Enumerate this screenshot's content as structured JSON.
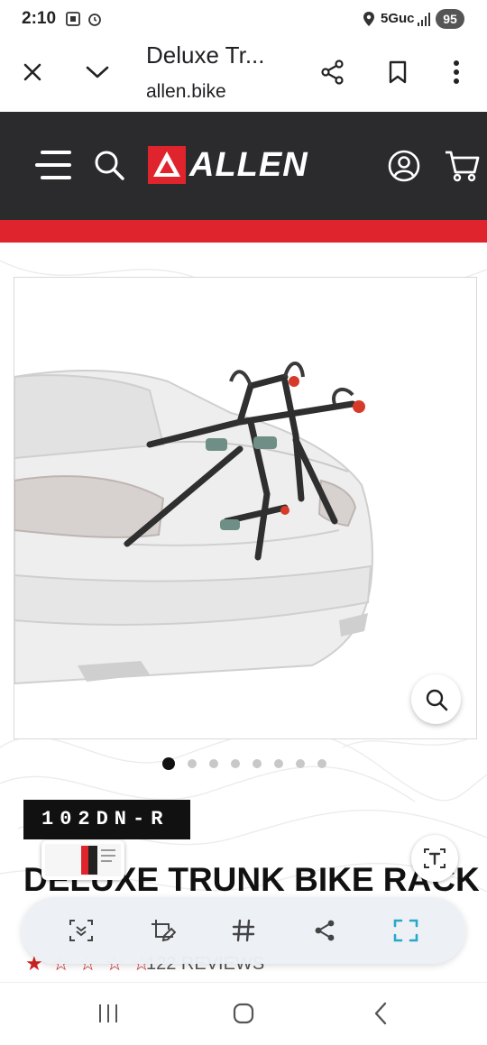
{
  "status_bar": {
    "time": "2:10",
    "network": "5Guc",
    "battery": "95"
  },
  "custom_tab": {
    "title": "Deluxe Tr...",
    "domain": "allen.bike"
  },
  "site": {
    "logo_text": "ALLEN",
    "accent_color": "#e0242d",
    "header_color": "#2b2b2d"
  },
  "product": {
    "sku": "102DN-R",
    "title": "DELUXE TRUNK BIKE RACK",
    "image_count": 8,
    "active_image_index": 0,
    "rating_stars": 5,
    "reviews_text": "122 REVIEWS"
  },
  "icons": {
    "close": "close-icon",
    "chevron": "chevron-down-icon",
    "share": "share-icon",
    "bookmark": "bookmark-icon",
    "more": "more-vert-icon",
    "menu": "menu-icon",
    "search": "search-icon",
    "account": "account-icon",
    "cart": "cart-icon",
    "zoom": "zoom-icon"
  }
}
